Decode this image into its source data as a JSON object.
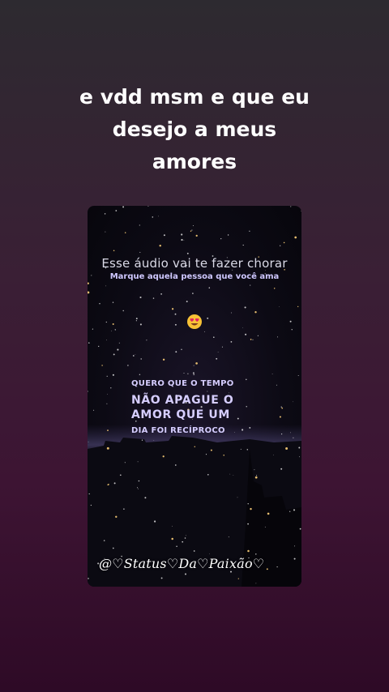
{
  "story": {
    "caption_lines": [
      "e vdd msm e que eu",
      "desejo a meus",
      "amores"
    ]
  },
  "post": {
    "title": "Esse áudio vai te fazer chorar",
    "subtitle": "Marque aquela pessoa que você ama",
    "emoji": "smiling-face-with-heart-eyes",
    "quote_line1": "QUERO QUE O TEMPO",
    "quote_line2": "NÃO APAGUE O",
    "quote_line3": "AMOR QUE UM",
    "quote_line4": "DIA FOI RECÍPROCO",
    "watermark": "@♡Status♡Da♡Paixão♡"
  },
  "colors": {
    "background_top": "#2d2a30",
    "background_bottom": "#2e0a26",
    "accent_text": "#d6ceff"
  }
}
